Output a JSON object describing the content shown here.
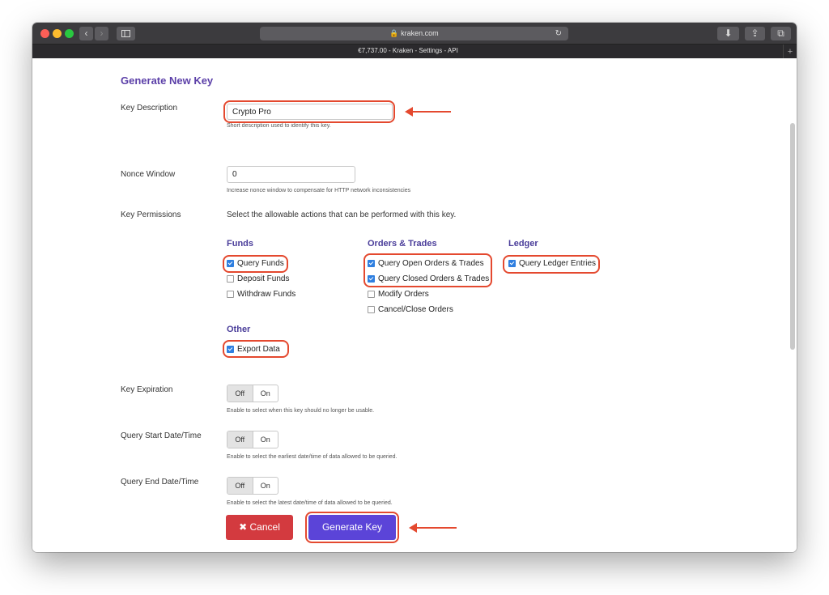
{
  "browser": {
    "url": "kraken.com",
    "tab_title": "€7,737.00 - Kraken - Settings - API"
  },
  "page": {
    "title": "Generate New Key",
    "key_description": {
      "label": "Key Description",
      "value": "Crypto Pro",
      "hint": "Short description used to identify this key."
    },
    "nonce_window": {
      "label": "Nonce Window",
      "value": "0",
      "hint": "Increase nonce window to compensate for HTTP network inconsistencies"
    },
    "permissions": {
      "label": "Key Permissions",
      "description": "Select the allowable actions that can be performed with this key.",
      "funds": {
        "title": "Funds",
        "items": [
          {
            "label": "Query Funds",
            "checked": true
          },
          {
            "label": "Deposit Funds",
            "checked": false
          },
          {
            "label": "Withdraw Funds",
            "checked": false
          }
        ]
      },
      "orders": {
        "title": "Orders & Trades",
        "items": [
          {
            "label": "Query Open Orders & Trades",
            "checked": true
          },
          {
            "label": "Query Closed Orders & Trades",
            "checked": true
          },
          {
            "label": "Modify Orders",
            "checked": false
          },
          {
            "label": "Cancel/Close Orders",
            "checked": false
          }
        ]
      },
      "ledger": {
        "title": "Ledger",
        "items": [
          {
            "label": "Query Ledger Entries",
            "checked": true
          }
        ]
      },
      "other": {
        "title": "Other",
        "items": [
          {
            "label": "Export Data",
            "checked": true
          }
        ]
      }
    },
    "key_expiration": {
      "label": "Key Expiration",
      "off": "Off",
      "on": "On",
      "hint": "Enable to select when this key should no longer be usable."
    },
    "query_start": {
      "label": "Query Start Date/Time",
      "off": "Off",
      "on": "On",
      "hint": "Enable to select the earliest date/time of data allowed to be queried."
    },
    "query_end": {
      "label": "Query End Date/Time",
      "off": "Off",
      "on": "On",
      "hint": "Enable to select the latest date/time of data allowed to be queried."
    },
    "cancel_label": "✖ Cancel",
    "generate_label": "Generate Key"
  },
  "colors": {
    "accent": "#5b44d8",
    "cancel": "#d33a3f",
    "highlight": "#e4492f",
    "heading": "#5b3fa8"
  }
}
